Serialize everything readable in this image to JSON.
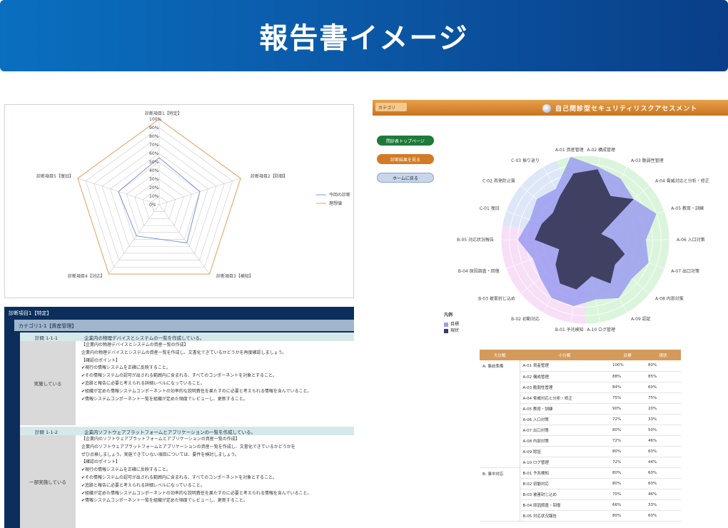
{
  "banner": {
    "title": "報告書イメージ"
  },
  "left_radar": {
    "top_label": "診断項目1【特定】",
    "right_label": "診断項目2【防御】",
    "bottom_right_label": "診断項目3【検知】",
    "bottom_left_label": "診断項目4【対応】",
    "left_label": "診断項目5【復旧】",
    "ticks": [
      "100%",
      "90%",
      "80%",
      "70%",
      "60%",
      "50%",
      "40%",
      "30%",
      "20%",
      "10%",
      "0%"
    ],
    "legend": [
      "今回の診断",
      "理想値"
    ],
    "colors": {
      "current": "#7c95d6",
      "ideal": "#e2a060"
    }
  },
  "report": {
    "header": "診断項目1【特定】",
    "category": "カテゴリ1-1【資産管理】",
    "items": [
      {
        "id": "診問 1-1-1",
        "title": "企業内の物理デバイスとシステムの一覧を作成している。",
        "status": "実施している",
        "lines": [
          "【企業内の物理デバイスとシステムの資産一覧の作成】",
          "企業内の物理デバイスとシステムの資産一覧を作成し、文書化できているかどうかを再度確認しましょう。",
          "【確認のポイント】",
          "✔現行の情報システムを正確に反映すること。",
          "✔その情報システムの認可が出される範囲内に含まれる、すべてのコンポーネントを対象とすること。",
          "✔追跡と報告に必要と考えられる詳細レベルになっていること。",
          "✔組織が定めた情報システムコンポーネントの効率的な説明責任を果たすのに必要と考えられる情報を含んでいること。",
          "✔情報システムコンポーネント一覧を組織が定めた頻度でレビューし、更新すること。"
        ]
      },
      {
        "id": "診問 1-1-2",
        "title": "企業内ソフトウェアプラットフォームとアプリケーションの一覧を作成している。",
        "status": "一部実施している",
        "lines": [
          "【企業内のソフトウェアプラットフォームとアプリケーションの資産一覧の作成】",
          "企業内のソフトウェアプラットフォームとアプリケーションの資産一覧を作成し、文書化できているかどうかを",
          "ぜひ点検しましょう。実施できていない項目については、要件を検討しましょう。",
          "【確認のポイント】",
          "✔現行の情報システムを正確に反映すること。",
          "✔その情報システムの認可が出される範囲内に含まれる、すべてのコンポーネントを対象とすること。",
          "✔追跡と報告に必要と考えられる詳細レベルになっていること。",
          "✔組織が定めた情報システムコンポーネントの効率的な説明責任を果たすのに必要と考えられる情報を含んでいること。",
          "✔情報システムコンポーネント一覧を組織が定めた頻度でレビューし、更新すること。"
        ]
      }
    ]
  },
  "app": {
    "tab": "カテゴリ",
    "title": "自己問診型セキュリティリスクアセスメント",
    "buttons": {
      "green": "問診表トップページ",
      "orange": "診断結果を見る",
      "blue": "ホームに戻る"
    },
    "legend_title": "凡例",
    "legend_items": [
      "目標",
      "現状"
    ],
    "axis_labels": [
      "A-01 資産管理",
      "A-02 構成管理",
      "A-03 脆弱性管理",
      "A-04 脅威対応と分析・修正",
      "A-05 教育・訓練",
      "A-06 入口対策",
      "A-07 出口対策",
      "A-08 内部対策",
      "A-09 認証",
      "A-10 ログ管理",
      "B-01 予兆検知",
      "B-02 初動対応",
      "B-03 被害封じ込め",
      "B-04 原因調査・回復",
      "B-05 対応状況報告",
      "C-01 復旧",
      "C-02 再発防止策",
      "C-03 振り返り"
    ],
    "table_headers": [
      "大分類",
      "小分類",
      "目標",
      "現状"
    ],
    "table_groups": [
      "A: 事前準備",
      "B: 事中対応"
    ],
    "table_rows": [
      [
        "A-01 資産管理",
        "100%",
        "80%"
      ],
      [
        "A-02 構成管理",
        "88%",
        "85%"
      ],
      [
        "A-03 脆弱性管理",
        "84%",
        "60%"
      ],
      [
        "A-04 脅威対応と分析・修正",
        "75%",
        "75%"
      ],
      [
        "A-05 教育・訓練",
        "90%",
        "20%"
      ],
      [
        "A-06 入口対策",
        "72%",
        "33%"
      ],
      [
        "A-07 出口対策",
        "80%",
        "50%"
      ],
      [
        "A-08 内部対策",
        "72%",
        "46%"
      ],
      [
        "A-09 認証",
        "80%",
        "60%"
      ],
      [
        "A-10 ログ管理",
        "72%",
        "44%"
      ],
      [
        "B-01 予兆検知",
        "80%",
        "60%"
      ],
      [
        "B-02 初動対応",
        "80%",
        "60%"
      ],
      [
        "B-03 被害封じ込め",
        "70%",
        "46%"
      ],
      [
        "B-04 原因調査・回復",
        "66%",
        "33%"
      ],
      [
        "B-05 対応状況報告",
        "80%",
        "60%"
      ]
    ]
  }
}
